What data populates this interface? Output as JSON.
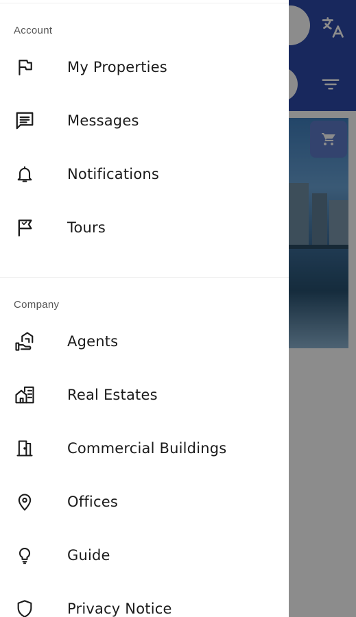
{
  "drawer": {
    "sections": [
      {
        "title": "Account",
        "items": [
          {
            "label": "My Properties",
            "icon": "flag-icon"
          },
          {
            "label": "Messages",
            "icon": "message-icon"
          },
          {
            "label": "Notifications",
            "icon": "bell-icon"
          },
          {
            "label": "Tours",
            "icon": "tour-flag-icon"
          }
        ]
      },
      {
        "title": "Company",
        "items": [
          {
            "label": "Agents",
            "icon": "agent-hand-house-icon"
          },
          {
            "label": "Real Estates",
            "icon": "real-estate-icon"
          },
          {
            "label": "Commercial Buildings",
            "icon": "door-building-icon"
          },
          {
            "label": "Offices",
            "icon": "location-pin-icon"
          },
          {
            "label": "Guide",
            "icon": "lightbulb-icon"
          },
          {
            "label": "Privacy Notice",
            "icon": "shield-icon"
          }
        ]
      }
    ]
  },
  "background": {
    "header_color": "#2c49a9",
    "icons": [
      "translate-icon",
      "filter-icon",
      "cart-icon"
    ]
  }
}
